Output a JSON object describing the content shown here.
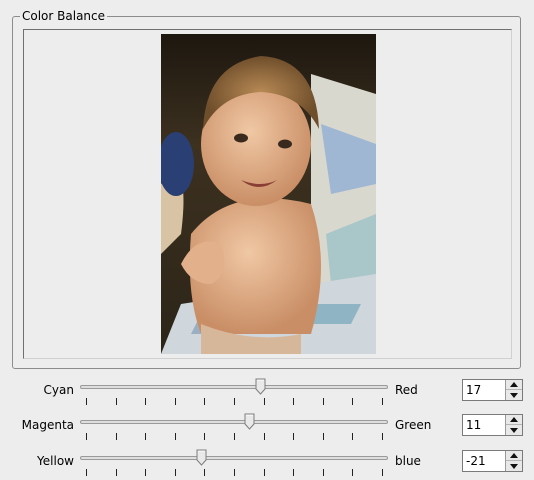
{
  "group": {
    "title": "Color Balance"
  },
  "preview": {
    "image_description_icon": "baby-photo"
  },
  "sliders": [
    {
      "left_label": "Cyan",
      "right_label": "Red",
      "value": "17",
      "position": 0.585
    },
    {
      "left_label": "Magenta",
      "right_label": "Green",
      "value": "11",
      "position": 0.55
    },
    {
      "left_label": "Yellow",
      "right_label": "blue",
      "value": "-21",
      "position": 0.395
    }
  ],
  "colors": {
    "background": "#ededed",
    "track": "#dedede",
    "border": "#8c8c8c"
  },
  "icons": {
    "spin_up": "arrow-up-icon",
    "spin_down": "arrow-down-icon"
  }
}
